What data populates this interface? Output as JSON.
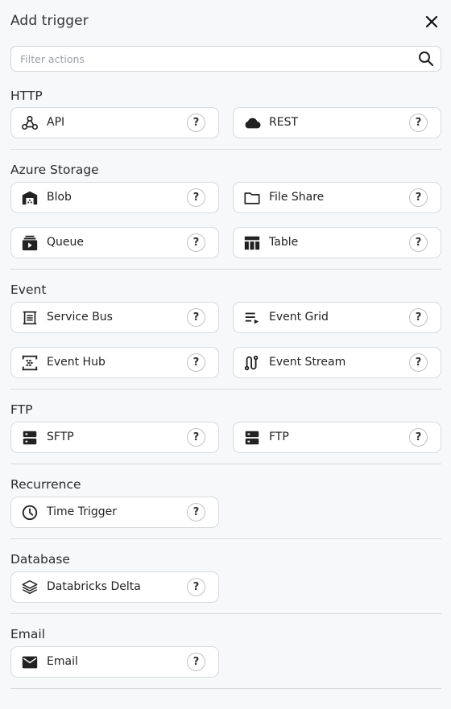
{
  "header": {
    "title": "Add trigger"
  },
  "search": {
    "placeholder": "Filter actions"
  },
  "help_label": "?",
  "sections": [
    {
      "title": "HTTP",
      "items": [
        {
          "label": "API",
          "icon": "webhook-icon"
        },
        {
          "label": "REST",
          "icon": "cloud-icon"
        }
      ]
    },
    {
      "title": "Azure Storage",
      "items": [
        {
          "label": "Blob",
          "icon": "warehouse-icon"
        },
        {
          "label": "File Share",
          "icon": "folder-icon"
        },
        {
          "label": "Queue",
          "icon": "queue-icon"
        },
        {
          "label": "Table",
          "icon": "table-icon"
        }
      ]
    },
    {
      "title": "Event",
      "items": [
        {
          "label": "Service Bus",
          "icon": "inbox-icon"
        },
        {
          "label": "Event Grid",
          "icon": "playlist-icon"
        },
        {
          "label": "Event Hub",
          "icon": "hub-icon"
        },
        {
          "label": "Event Stream",
          "icon": "stream-icon"
        }
      ]
    },
    {
      "title": "FTP",
      "items": [
        {
          "label": "SFTP",
          "icon": "server-icon"
        },
        {
          "label": "FTP",
          "icon": "server-icon"
        }
      ]
    },
    {
      "title": "Recurrence",
      "items": [
        {
          "label": "Time Trigger",
          "icon": "clock-icon"
        }
      ]
    },
    {
      "title": "Database",
      "items": [
        {
          "label": "Databricks Delta",
          "icon": "layers-icon"
        }
      ]
    },
    {
      "title": "Email",
      "items": [
        {
          "label": "Email",
          "icon": "envelope-icon"
        }
      ]
    }
  ]
}
